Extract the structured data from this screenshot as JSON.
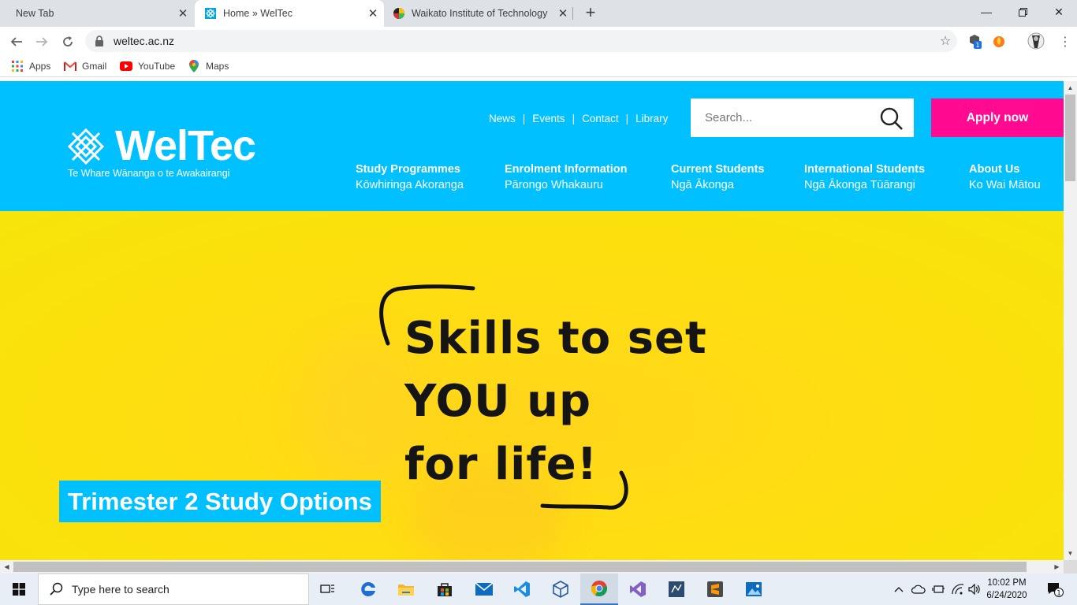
{
  "browser": {
    "tabs": [
      {
        "title": "New Tab",
        "active": false
      },
      {
        "title": "Home » WelTec",
        "active": true
      },
      {
        "title": "Waikato Institute of Technology",
        "active": false
      }
    ],
    "url": "weltec.ac.nz",
    "bookmarks": [
      {
        "label": "Apps",
        "icon": "apps-grid-icon"
      },
      {
        "label": "Gmail",
        "icon": "gmail-icon"
      },
      {
        "label": "YouTube",
        "icon": "youtube-icon"
      },
      {
        "label": "Maps",
        "icon": "maps-icon"
      }
    ],
    "extension_badge": "1"
  },
  "site": {
    "logo": {
      "name": "WelTec",
      "tagline": "Te Whare Wānanga o te Awakairangi"
    },
    "utility_nav": [
      "News",
      "Events",
      "Contact",
      "Library"
    ],
    "search_placeholder": "Search...",
    "apply_label": "Apply now",
    "main_nav": [
      {
        "en": "Study Programmes",
        "mi": "Kōwhiringa Akoranga"
      },
      {
        "en": "Enrolment Information",
        "mi": "Pārongo Whakauru"
      },
      {
        "en": "Current Students",
        "mi": "Ngā Ākonga"
      },
      {
        "en": "International Students",
        "mi": "Ngā Ākonga Tūārangi"
      },
      {
        "en": "About Us",
        "mi": "Ko Wai Mātou"
      }
    ],
    "hero": {
      "lines": [
        "Skills to set",
        "YOU up",
        "for life!"
      ],
      "caption": "Trimester 2 Study Options"
    },
    "colors": {
      "brand_blue": "#00c0ff",
      "apply_pink": "#ff0a91",
      "hero_yellow": "#fce00e"
    }
  },
  "taskbar": {
    "search_placeholder": "Type here to search",
    "apps": [
      "task-view-icon",
      "edge-icon",
      "file-explorer-icon",
      "store-icon",
      "mail-icon",
      "vscode-icon",
      "3d-viewer-icon",
      "chrome-icon",
      "visual-studio-icon",
      "sql-tool-icon",
      "sublime-icon",
      "photos-icon"
    ],
    "time": "10:02 PM",
    "date": "6/24/2020",
    "notification_count": "1"
  }
}
